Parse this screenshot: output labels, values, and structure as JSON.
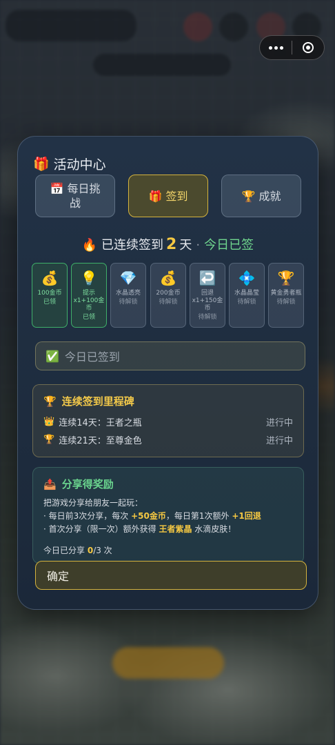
{
  "modal": {
    "title_icon": "🎁",
    "title": "活动中心",
    "tabs": [
      {
        "icon": "📅",
        "label": "每日挑战"
      },
      {
        "icon": "🎁",
        "label": "签到"
      },
      {
        "icon": "🏆",
        "label": "成就"
      }
    ],
    "streak": {
      "icon": "🔥",
      "prefix": "已连续签到",
      "days": "2",
      "suffix": "天",
      "separator": "·",
      "today": "今日已签"
    },
    "days": [
      {
        "icon": "💰",
        "reward": "100金币",
        "status": "已领"
      },
      {
        "icon": "💡",
        "reward": "提示x1+100金币",
        "status": "已领"
      },
      {
        "icon": "💎",
        "reward": "水晶透亮",
        "status": "待解锁"
      },
      {
        "icon": "💰",
        "reward": "200金币",
        "status": "待解锁"
      },
      {
        "icon": "↩️",
        "reward": "回退x1+150金币",
        "status": "待解锁"
      },
      {
        "icon": "💠",
        "reward": "水晶晶莹",
        "status": "待解锁"
      },
      {
        "icon": "🏆",
        "reward": "黄金勇者瓶",
        "status": "待解锁"
      }
    ],
    "signed_button": {
      "icon": "✅",
      "label": "今日已签到"
    },
    "milestones": {
      "icon": "🏆",
      "title": "连续签到里程碑",
      "items": [
        {
          "icon": "👑",
          "label": "连续14天：王者之瓶",
          "state": "进行中"
        },
        {
          "icon": "🏆",
          "label": "连续21天：至尊金色",
          "state": "进行中"
        }
      ]
    },
    "share": {
      "icon": "📤",
      "title": "分享得奖励",
      "intro": "把游戏分享给朋友一起玩：",
      "line1_a": "· 每日前3次分享，每次 ",
      "line1_b": "+50金币",
      "line1_c": "，每日第1次额外 ",
      "line1_d": "+1回退",
      "line2_a": "· 首次分享（限一次）额外获得 ",
      "line2_b": "王者紫晶",
      "line2_c": " 水滴皮肤！",
      "progress_a": "今日已分享 ",
      "progress_count": "0",
      "progress_b": "/3 次"
    },
    "confirm": "确定"
  }
}
